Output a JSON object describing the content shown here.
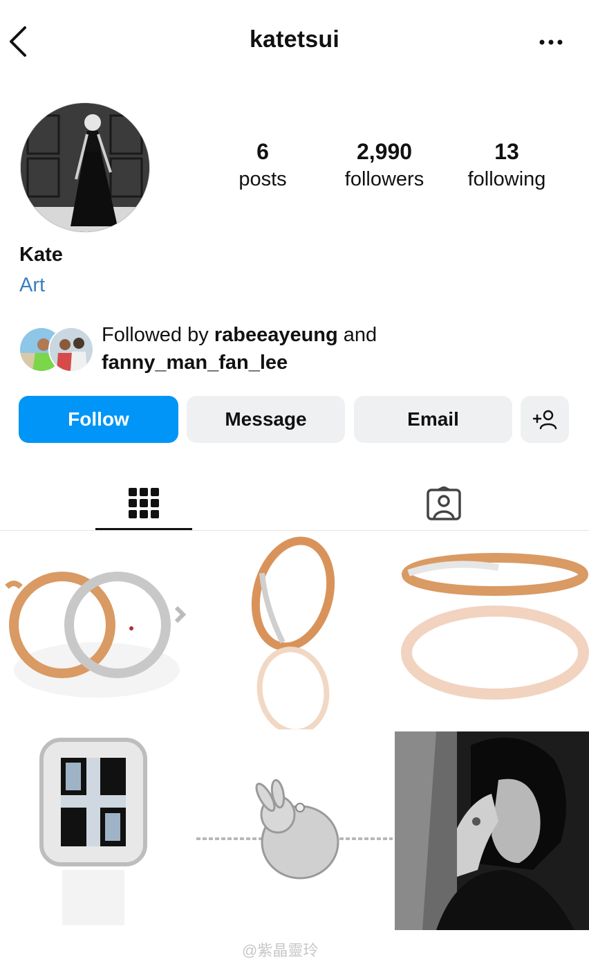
{
  "header": {
    "username": "katetsui",
    "back_icon": "chevron-left-icon",
    "more_icon": "more-horizontal-icon"
  },
  "profile": {
    "display_name": "Kate",
    "category": "Art",
    "stats": {
      "posts": {
        "value": "6",
        "label": "posts"
      },
      "followers": {
        "value": "2,990",
        "label": "followers"
      },
      "following": {
        "value": "13",
        "label": "following"
      }
    },
    "followed_by": {
      "prefix": "Followed by",
      "user1": "rabeeayeung",
      "joiner": "and",
      "user2": "fanny_man_fan_lee"
    }
  },
  "actions": {
    "follow_label": "Follow",
    "message_label": "Message",
    "email_label": "Email",
    "add_icon": "add-person-icon"
  },
  "tabs": [
    {
      "icon": "grid-icon",
      "active": true
    },
    {
      "icon": "tagged-person-icon",
      "active": false
    }
  ],
  "posts": [
    {
      "subject": "interlocking gold and silver rings"
    },
    {
      "subject": "gold and silver ring"
    },
    {
      "subject": "stacked two-tone bangle"
    },
    {
      "subject": "diamond mosaic signet ring"
    },
    {
      "subject": "diamond rabbit bracelet"
    },
    {
      "subject": "black and white portrait"
    }
  ],
  "watermark": "@紫晶靈玲",
  "colors": {
    "accent": "#0095f6",
    "link": "#3a7fc4",
    "button_gray": "#eff0f2"
  }
}
